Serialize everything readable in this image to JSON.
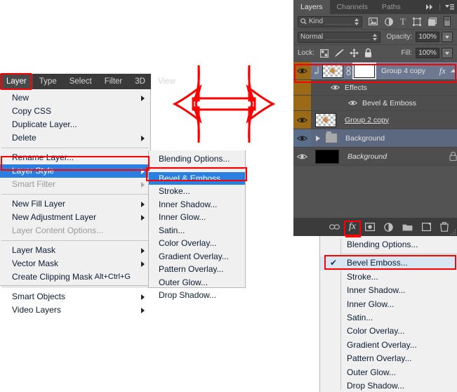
{
  "app": "Adobe Photoshop Layer Style access",
  "accent_red": "#ff0000",
  "accent_blue": "#2a7fe0",
  "menubar": {
    "items": [
      {
        "label": "Layer",
        "active": true
      },
      {
        "label": "Type",
        "active": false
      },
      {
        "label": "Select",
        "active": false
      },
      {
        "label": "Filter",
        "active": false
      },
      {
        "label": "3D",
        "active": false
      },
      {
        "label": "View",
        "active": false
      }
    ]
  },
  "layer_menu": {
    "items": [
      {
        "label": "New",
        "arrow": true,
        "disabled": false,
        "selected": false,
        "accel": ""
      },
      {
        "label": "Copy CSS",
        "arrow": false,
        "disabled": false,
        "selected": false,
        "accel": ""
      },
      {
        "label": "Duplicate Layer...",
        "arrow": false,
        "disabled": false,
        "selected": false,
        "accel": ""
      },
      {
        "label": "Delete",
        "arrow": true,
        "disabled": false,
        "selected": false,
        "accel": ""
      },
      {
        "separator": true
      },
      {
        "label": "Rename Layer...",
        "arrow": false,
        "disabled": false,
        "selected": false,
        "accel": ""
      },
      {
        "label": "Layer Style",
        "arrow": true,
        "disabled": false,
        "selected": true,
        "accel": ""
      },
      {
        "label": "Smart Filter",
        "arrow": true,
        "disabled": true,
        "selected": false,
        "accel": ""
      },
      {
        "separator": true
      },
      {
        "label": "New Fill Layer",
        "arrow": true,
        "disabled": false,
        "selected": false,
        "accel": ""
      },
      {
        "label": "New Adjustment Layer",
        "arrow": true,
        "disabled": false,
        "selected": false,
        "accel": ""
      },
      {
        "label": "Layer Content Options...",
        "arrow": false,
        "disabled": true,
        "selected": false,
        "accel": ""
      },
      {
        "separator": true
      },
      {
        "label": "Layer Mask",
        "arrow": true,
        "disabled": false,
        "selected": false,
        "accel": ""
      },
      {
        "label": "Vector Mask",
        "arrow": true,
        "disabled": false,
        "selected": false,
        "accel": ""
      },
      {
        "label": "Create Clipping Mask",
        "arrow": false,
        "disabled": false,
        "selected": false,
        "accel": "Alt+Ctrl+G"
      },
      {
        "separator": true
      },
      {
        "label": "Smart Objects",
        "arrow": true,
        "disabled": false,
        "selected": false,
        "accel": ""
      },
      {
        "label": "Video Layers",
        "arrow": true,
        "disabled": false,
        "selected": false,
        "accel": ""
      }
    ]
  },
  "layer_style_submenu": {
    "items": [
      {
        "label": "Blending Options...",
        "selected": false
      },
      {
        "separator": true
      },
      {
        "label": "Bevel & Emboss...",
        "selected": true
      },
      {
        "label": "Stroke...",
        "selected": false
      },
      {
        "label": "Inner Shadow...",
        "selected": false
      },
      {
        "label": "Inner Glow...",
        "selected": false
      },
      {
        "label": "Satin...",
        "selected": false
      },
      {
        "label": "Color Overlay...",
        "selected": false
      },
      {
        "label": "Gradient Overlay...",
        "selected": false
      },
      {
        "label": "Pattern Overlay...",
        "selected": false
      },
      {
        "label": "Outer Glow...",
        "selected": false
      },
      {
        "label": "Drop Shadow...",
        "selected": false
      }
    ]
  },
  "layers_panel": {
    "tabs": [
      {
        "label": "Layers",
        "active": true
      },
      {
        "label": "Channels",
        "active": false
      },
      {
        "label": "Paths",
        "active": false
      }
    ],
    "collapse_icon": "double-chevron-right-icon",
    "menu_icon": "panel-menu-icon",
    "filter": {
      "kind_label": "Kind",
      "search_icon": "magnifier-icon",
      "icons": [
        "pixel-layer-filter-icon",
        "adjustment-layer-filter-icon",
        "type-layer-filter-icon",
        "shape-layer-filter-icon",
        "smart-object-filter-icon",
        "filter-toggle-switch-icon"
      ]
    },
    "blend": {
      "mode": "Normal",
      "opacity_label": "Opacity:",
      "opacity_value": "100%"
    },
    "lock": {
      "lock_label": "Lock:",
      "icons": [
        "lock-transparent-pixels-icon",
        "lock-image-pixels-icon",
        "lock-position-icon",
        "lock-all-icon"
      ],
      "fill_label": "Fill:",
      "fill_value": "100%"
    },
    "rows": [
      {
        "name": "Group 4 copy",
        "visible": true,
        "selected": true,
        "kind": "clipped-smart-object-with-mask",
        "has_fx": true,
        "eye_color": "orange",
        "indent": 0,
        "style": "normal",
        "locked": false,
        "fx_badge": "fx",
        "expand_arrow": "up"
      },
      {
        "name": "Effects",
        "visible": true,
        "selected": false,
        "kind": "effects-group",
        "eye_color": "orange",
        "indent": 1,
        "style": "normal",
        "locked": false
      },
      {
        "name": "Bevel & Emboss",
        "visible": true,
        "selected": false,
        "kind": "effect-item",
        "eye_color": "orange",
        "indent": 2,
        "style": "normal",
        "locked": false
      },
      {
        "name": "Group 2 copy",
        "visible": true,
        "selected": false,
        "kind": "pixel-layer",
        "eye_color": "orange",
        "indent": 0,
        "style": "underline",
        "locked": false
      },
      {
        "name": "Background",
        "visible": true,
        "selected": false,
        "kind": "group-folder",
        "eye_color": "blue",
        "indent": 0,
        "style": "normal",
        "locked": false
      },
      {
        "name": "Background",
        "visible": true,
        "selected": false,
        "kind": "black-thumb-layer",
        "eye_color": "gray",
        "indent": 0,
        "style": "italic",
        "locked": true,
        "lock_icon": "padlock-icon"
      }
    ],
    "bottom_toolbar": [
      "link-layers-icon",
      "add-layer-style-fx-icon",
      "add-layer-mask-icon",
      "new-adjustment-layer-icon",
      "new-group-icon",
      "new-layer-icon",
      "delete-layer-icon"
    ]
  },
  "fx_context_menu": {
    "items": [
      {
        "label": "Blending Options...",
        "checked": false,
        "selected": false
      },
      {
        "separator": true
      },
      {
        "label": "Bevel  Emboss...",
        "checked": true,
        "selected": true
      },
      {
        "label": "Stroke...",
        "checked": false,
        "selected": false
      },
      {
        "label": "Inner Shadow...",
        "checked": false,
        "selected": false
      },
      {
        "label": "Inner Glow...",
        "checked": false,
        "selected": false
      },
      {
        "label": "Satin...",
        "checked": false,
        "selected": false
      },
      {
        "label": "Color Overlay...",
        "checked": false,
        "selected": false
      },
      {
        "label": "Gradient Overlay...",
        "checked": false,
        "selected": false
      },
      {
        "label": "Pattern Overlay...",
        "checked": false,
        "selected": false
      },
      {
        "label": "Outer Glow...",
        "checked": false,
        "selected": false
      },
      {
        "label": "Drop Shadow...",
        "checked": false,
        "selected": false
      }
    ],
    "check_glyph": "✔"
  },
  "annotation": {
    "arrow_icon": "red-double-headed-arrow",
    "arrow_color": "#ff0000"
  }
}
